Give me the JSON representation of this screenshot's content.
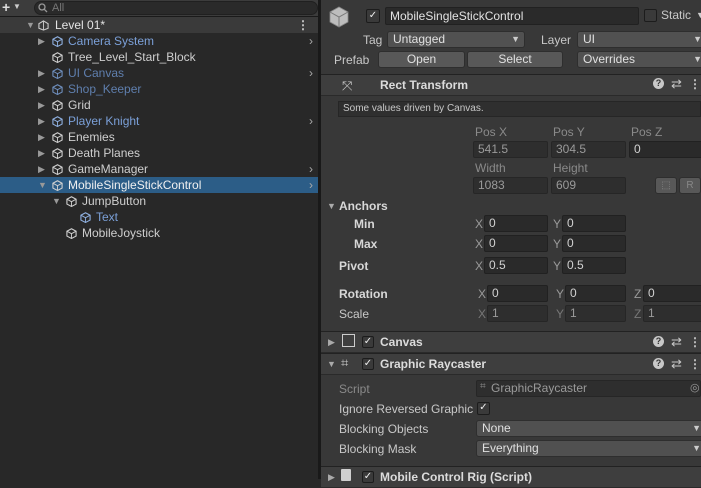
{
  "hierarchy": {
    "search_placeholder": "All",
    "scene_name": "Level 01*",
    "items": [
      {
        "label": "Camera System",
        "style": "blue",
        "fold": "▶",
        "chevron": "›"
      },
      {
        "label": "Tree_Level_Start_Block",
        "style": "normal",
        "fold": "",
        "chevron": ""
      },
      {
        "label": "UI Canvas",
        "style": "dimblue",
        "fold": "▶",
        "chevron": "›"
      },
      {
        "label": "Shop_Keeper",
        "style": "dimblue",
        "fold": "▶",
        "chevron": ""
      },
      {
        "label": "Grid",
        "style": "normal",
        "fold": "▶",
        "chevron": ""
      },
      {
        "label": "Player Knight",
        "style": "blue",
        "fold": "▶",
        "chevron": "›"
      },
      {
        "label": "Enemies",
        "style": "normal",
        "fold": "▶",
        "chevron": ""
      },
      {
        "label": "Death Planes",
        "style": "normal",
        "fold": "▶",
        "chevron": ""
      },
      {
        "label": "GameManager",
        "style": "normal",
        "fold": "▶",
        "chevron": "›"
      },
      {
        "label": "MobileSingleStickControl",
        "style": "selected",
        "fold": "▼",
        "chevron": "›"
      },
      {
        "label": "JumpButton",
        "style": "normal",
        "fold": "▼",
        "chevron": ""
      },
      {
        "label": "Text",
        "style": "blue",
        "fold": "",
        "chevron": ""
      },
      {
        "label": "MobileJoystick",
        "style": "normal",
        "fold": "",
        "chevron": ""
      }
    ]
  },
  "inspector": {
    "object_name": "MobileSingleStickControl",
    "static_label": "Static",
    "tag_label": "Tag",
    "tag_value": "Untagged",
    "layer_label": "Layer",
    "layer_value": "UI",
    "prefab_label": "Prefab",
    "open_label": "Open",
    "select_label": "Select",
    "overrides_label": "Overrides",
    "rect_transform": {
      "title": "Rect Transform",
      "note": "Some values driven by Canvas.",
      "pos_x_label": "Pos X",
      "pos_y_label": "Pos Y",
      "pos_z_label": "Pos Z",
      "pos_x": "541.5",
      "pos_y": "304.5",
      "pos_z": "0",
      "width_label": "Width",
      "height_label": "Height",
      "width": "1083",
      "height": "609",
      "r_button": "R",
      "anchors_label": "Anchors",
      "min_label": "Min",
      "max_label": "Max",
      "min_x": "0",
      "min_y": "0",
      "max_x": "0",
      "max_y": "0",
      "pivot_label": "Pivot",
      "pivot_x": "0.5",
      "pivot_y": "0.5",
      "rotation_label": "Rotation",
      "rot_x": "0",
      "rot_y": "0",
      "rot_z": "0",
      "scale_label": "Scale",
      "scale_x": "1",
      "scale_y": "1",
      "scale_z": "1",
      "x": "X",
      "y": "Y",
      "z": "Z"
    },
    "canvas_title": "Canvas",
    "graphic_raycaster": {
      "title": "Graphic Raycaster",
      "script_label": "Script",
      "script_value": "GraphicRaycaster",
      "ignore_label": "Ignore Reversed Graphic",
      "blocking_objects_label": "Blocking Objects",
      "blocking_objects_value": "None",
      "blocking_mask_label": "Blocking Mask",
      "blocking_mask_value": "Everything"
    },
    "mobile_rig_title": "Mobile Control Rig (Script)"
  }
}
